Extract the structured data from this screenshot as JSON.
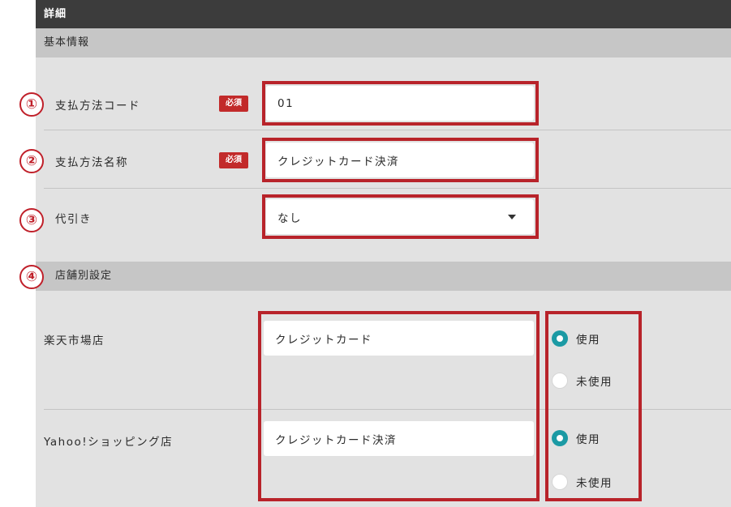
{
  "header": {
    "title": "詳細"
  },
  "basic_section": {
    "title": "基本情報"
  },
  "form": {
    "payment_code": {
      "label": "支払方法コード",
      "required_badge": "必須",
      "value": "01"
    },
    "payment_name": {
      "label": "支払方法名称",
      "required_badge": "必須",
      "value": "クレジットカード決済"
    },
    "cash_on_delivery": {
      "label": "代引き",
      "selected": "なし"
    }
  },
  "store_section": {
    "title": "店舗別設定"
  },
  "stores": [
    {
      "label": "楽天市場店",
      "value": "クレジットカード",
      "options": [
        {
          "label": "使用",
          "checked": true
        },
        {
          "label": "未使用",
          "checked": false
        }
      ]
    },
    {
      "label": "Yahoo!ショッピング店",
      "value": "クレジットカード決済",
      "options": [
        {
          "label": "使用",
          "checked": true
        },
        {
          "label": "未使用",
          "checked": false
        }
      ]
    }
  ],
  "annotations": {
    "markers": [
      "①",
      "②",
      "③",
      "④"
    ],
    "marker_color": "#c0202a"
  },
  "colors": {
    "accent": "#1b9aa4",
    "required": "#c22a2a",
    "header_bg": "#3c3c3c"
  }
}
